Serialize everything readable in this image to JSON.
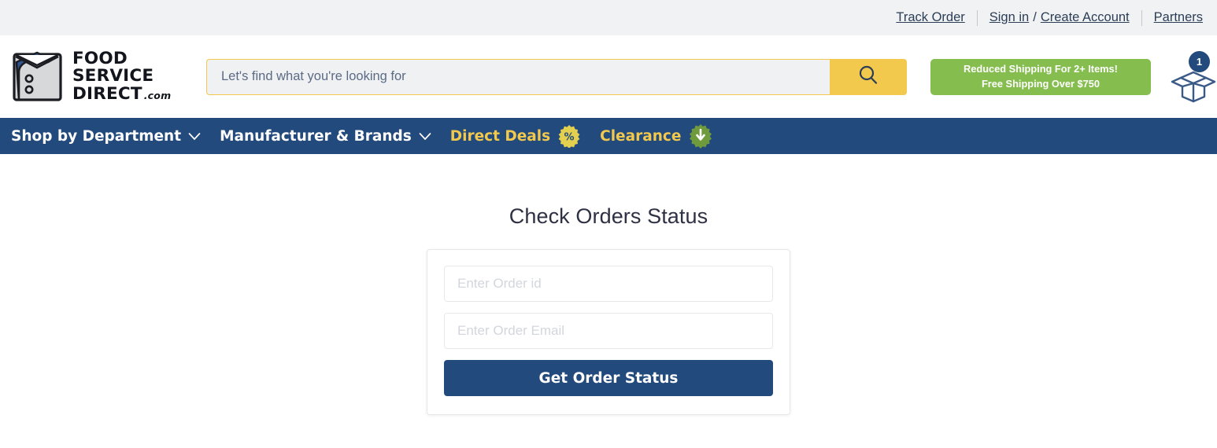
{
  "utility_bar": {
    "links": [
      {
        "label": "Track Order",
        "name": "track-order-link"
      },
      {
        "label": "Sign in",
        "name": "sign-in-link"
      },
      {
        "label": "Create Account",
        "name": "create-account-link"
      },
      {
        "label": "Partners",
        "name": "partners-link"
      }
    ],
    "separator_slash": "/"
  },
  "header": {
    "logo": {
      "line1": "FOOD SERVICE",
      "line2": "DIRECT",
      "suffix": ".com",
      "icon": "chef-coat-icon"
    },
    "search": {
      "placeholder": "Let's find what you're looking for",
      "value": "",
      "button_icon": "search-icon"
    },
    "promo": {
      "line1": "Reduced Shipping For 2+ Items!",
      "line2": "Free Shipping Over $750"
    },
    "cart": {
      "count": "1",
      "icon": "open-box-icon"
    }
  },
  "nav": {
    "items": [
      {
        "label": "Shop by Department",
        "accent": false,
        "chevron": true,
        "badge": null,
        "name": "nav-shop-by-department"
      },
      {
        "label": "Manufacturer & Brands",
        "accent": false,
        "chevron": true,
        "badge": null,
        "name": "nav-manufacturer-brands"
      },
      {
        "label": "Direct Deals",
        "accent": true,
        "chevron": false,
        "badge": "percent-badge",
        "name": "nav-direct-deals"
      },
      {
        "label": "Clearance",
        "accent": true,
        "chevron": false,
        "badge": "clearance-arrow-badge",
        "name": "nav-clearance"
      }
    ]
  },
  "main": {
    "title": "Check Orders Status",
    "form": {
      "order_id_placeholder": "Enter Order id",
      "order_id_value": "",
      "order_email_placeholder": "Enter Order Email",
      "order_email_value": "",
      "submit_label": "Get Order Status"
    }
  },
  "colors": {
    "brand_blue": "#234a7d",
    "accent_yellow": "#f2c94c",
    "promo_green": "#85bd4f",
    "utility_bar_bg": "#f1f2f4",
    "page_bg": "#ffffff"
  }
}
